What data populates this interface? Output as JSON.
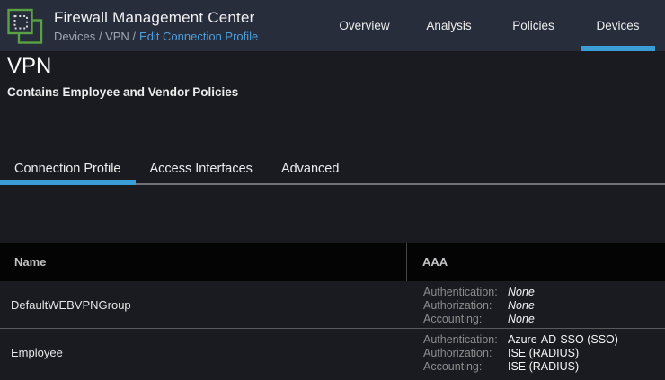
{
  "header": {
    "app_title": "Firewall Management Center",
    "breadcrumb": {
      "path": "Devices / VPN /",
      "current": "Edit Connection Profile"
    },
    "nav": {
      "overview": "Overview",
      "analysis": "Analysis",
      "policies": "Policies",
      "devices": "Devices",
      "active_item": "Devices"
    }
  },
  "page": {
    "title": "VPN",
    "subtitle": "Contains Employee and Vendor Policies"
  },
  "tabs": {
    "connection_profile": "Connection Profile",
    "access_interfaces": "Access Interfaces",
    "advanced": "Advanced",
    "active_tab": "Connection Profile"
  },
  "table": {
    "columns": {
      "name": "Name",
      "aaa": "AAA"
    },
    "rows": [
      {
        "name": "DefaultWEBVPNGroup",
        "aaa": {
          "authentication": {
            "label": "Authentication:",
            "value": "None"
          },
          "authorization": {
            "label": "Authorization:",
            "value": "None"
          },
          "accounting": {
            "label": "Accounting:",
            "value": "None"
          }
        }
      },
      {
        "name": "Employee",
        "aaa": {
          "authentication": {
            "label": "Authentication:",
            "value": "Azure-AD-SSO (SSO)"
          },
          "authorization": {
            "label": "Authorization:",
            "value": "ISE (RADIUS)"
          },
          "accounting": {
            "label": "Accounting:",
            "value": "ISE (RADIUS)"
          }
        }
      }
    ]
  },
  "colors": {
    "accent_blue": "#3b9dd6",
    "link_blue": "#4d9fdb",
    "logo_green": "#58a244",
    "topbar_bg": "#282d3c",
    "page_bg": "#1a1b20",
    "table_header_bg": "#040404"
  }
}
